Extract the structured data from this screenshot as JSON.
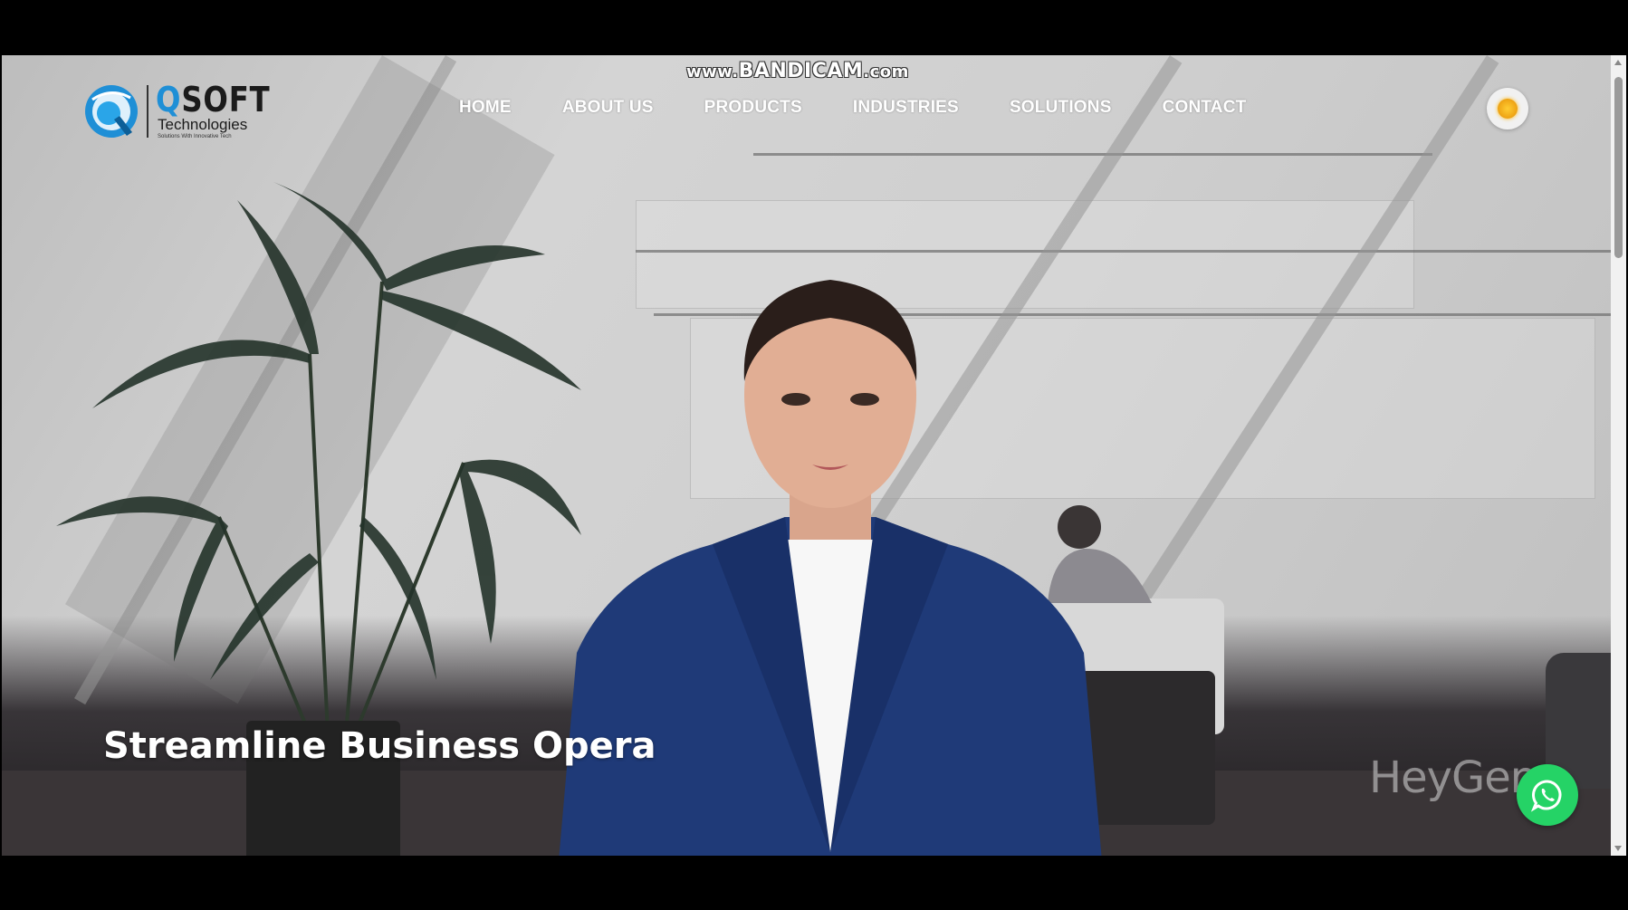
{
  "recording_watermark": {
    "prefix": "www.",
    "brand": "BANDICAM",
    "suffix": ".com"
  },
  "logo": {
    "brand_q": "Q",
    "brand_rest": "SOFT",
    "subtitle": "Technologies",
    "tagline": "Solutions With Innovative Tech",
    "icon": "qsoft-logo-icon"
  },
  "nav": {
    "items": [
      {
        "label": "HOME"
      },
      {
        "label": "ABOUT US"
      },
      {
        "label": "PRODUCTS"
      },
      {
        "label": "INDUSTRIES"
      },
      {
        "label": "SOLUTIONS"
      },
      {
        "label": "CONTACT"
      }
    ]
  },
  "theme_toggle": {
    "icon": "sun-icon"
  },
  "hero": {
    "heading": "Streamline Business Opera",
    "video_watermark": "HeyGen"
  },
  "whatsapp": {
    "icon": "whatsapp-icon"
  },
  "colors": {
    "brand_blue": "#1f8fd6",
    "whatsapp_green": "#25d366",
    "nav_text": "#ffffff",
    "presenter_jacket": "#1f3a78"
  }
}
